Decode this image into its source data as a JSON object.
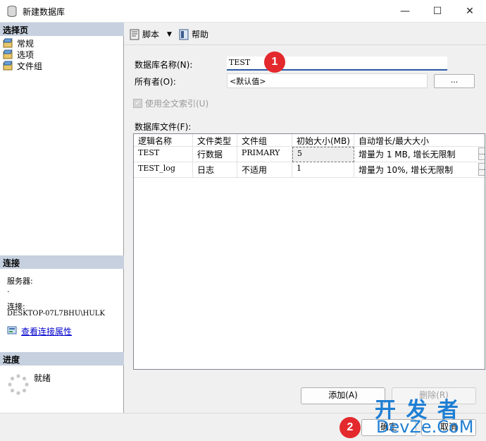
{
  "window": {
    "title": "新建数据库",
    "minimize_glyph": "—",
    "maximize_glyph": "☐",
    "close_glyph": "✕"
  },
  "sidebar": {
    "pages_header": "选择页",
    "pages": [
      {
        "label": "常规",
        "icon": "page-icon"
      },
      {
        "label": "选项",
        "icon": "page-icon"
      },
      {
        "label": "文件组",
        "icon": "page-icon"
      }
    ],
    "connection_header": "连接",
    "server_label": "服务器:",
    "server_value": ".",
    "connection_label": "连接:",
    "connection_value": "DESKTOP-07L7BHU\\HULK",
    "view_props_link": "查看连接属性",
    "progress_header": "进度",
    "progress_status": "就绪"
  },
  "toolbar": {
    "script_label": "脚本",
    "help_label": "帮助"
  },
  "form": {
    "db_name_label": "数据库名称(N):",
    "db_name_value": "TEST",
    "owner_label": "所有者(O):",
    "owner_value": "<默认值>",
    "owner_browse": "...",
    "fulltext_label": "使用全文索引(U)",
    "fulltext_checked": true,
    "files_label": "数据库文件(F):"
  },
  "files_table": {
    "columns": [
      "逻辑名称",
      "文件类型",
      "文件组",
      "初始大小(MB)",
      "自动增长/最大大小"
    ],
    "rows": [
      [
        "TEST",
        "行数据",
        "PRIMARY",
        "5",
        "增量为 1 MB, 增长无限制"
      ],
      [
        "TEST_log",
        "日志",
        "不适用",
        "1",
        "增量为 10%, 增长无限制"
      ]
    ],
    "row_button": "..."
  },
  "buttons": {
    "add": "添加(A)",
    "remove": "删除(R)",
    "ok": "确定",
    "cancel": "取消"
  },
  "annotations": {
    "badge1": "1",
    "badge2": "2"
  },
  "watermark": {
    "line1": "开 发 者",
    "line2": "DevZe.CoM"
  }
}
